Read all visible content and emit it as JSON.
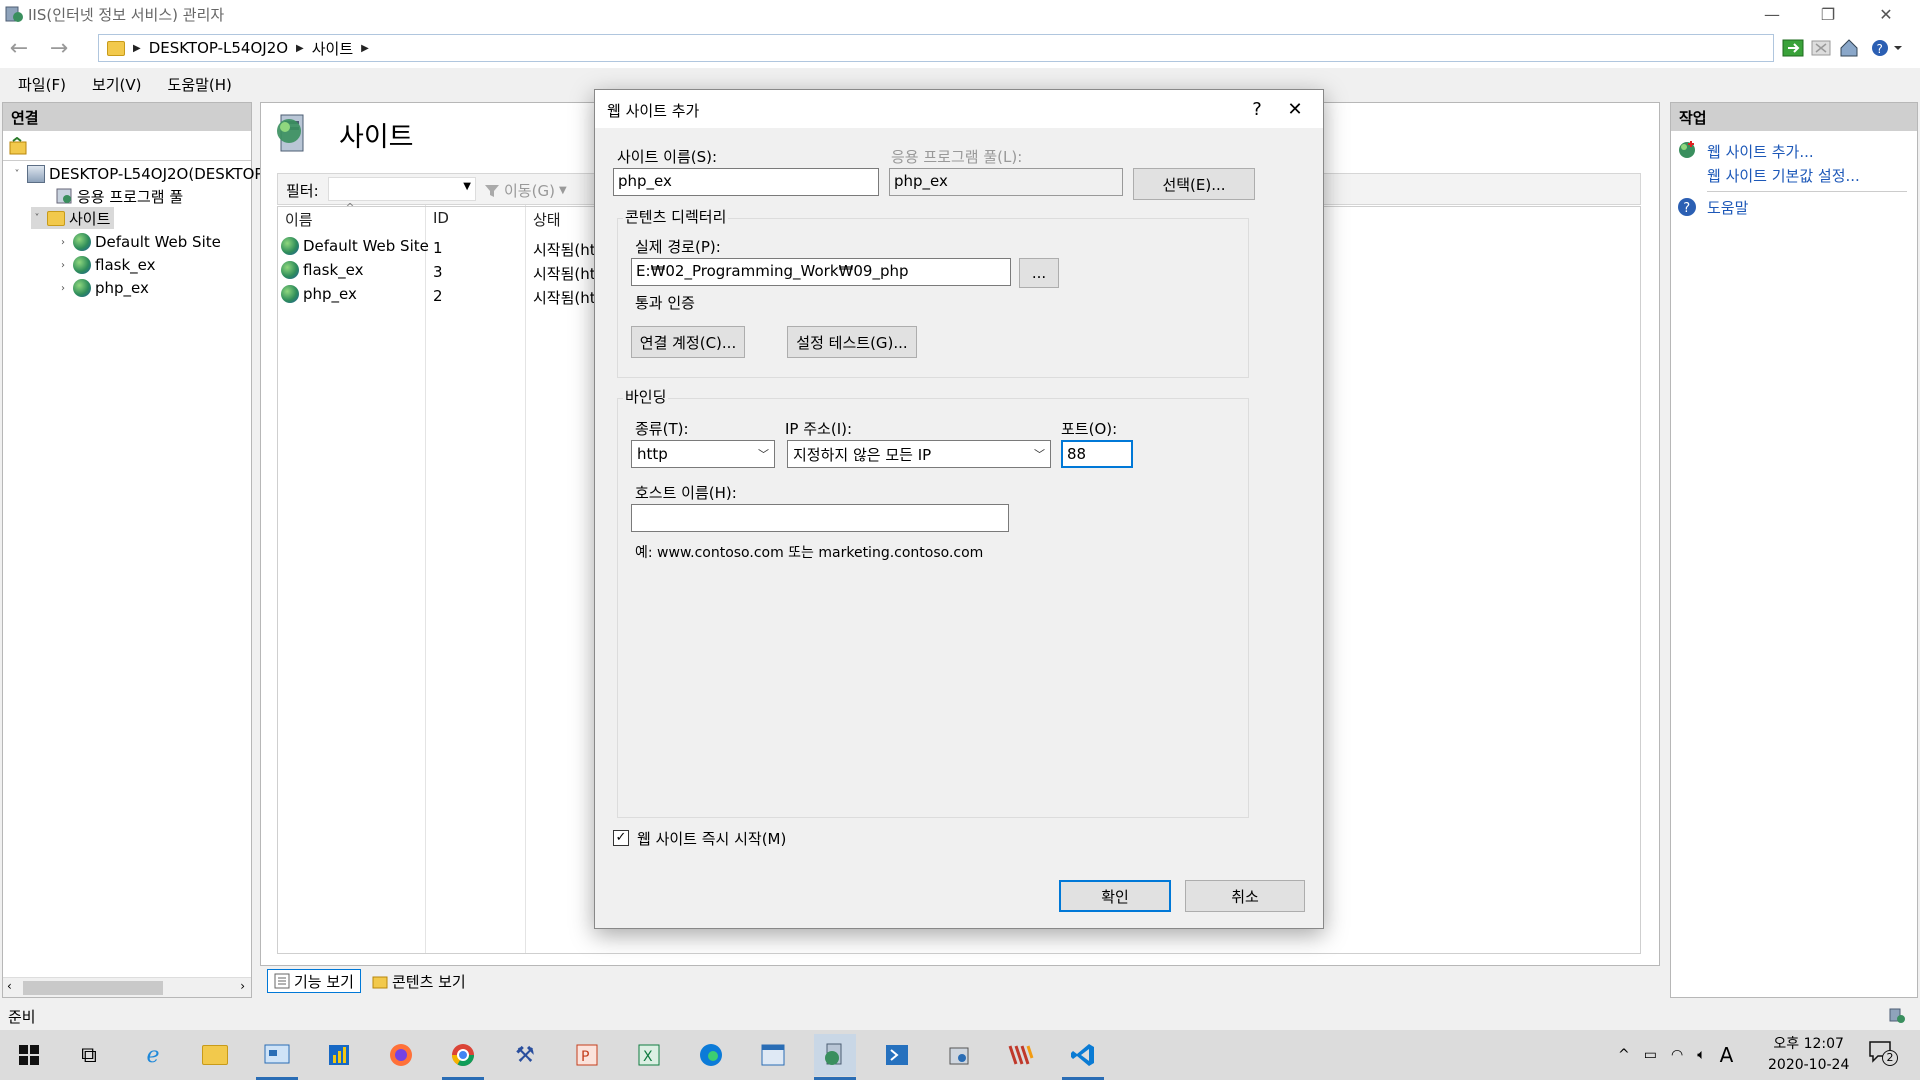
{
  "window": {
    "title": "IIS(인터넷 정보 서비스) 관리자"
  },
  "address": {
    "crumbs": [
      "DESKTOP-L54OJ2O",
      "사이트"
    ]
  },
  "menu": {
    "items": [
      "파일(F)",
      "보기(V)",
      "도움말(H)"
    ]
  },
  "connections": {
    "header": "연결",
    "tree": {
      "server": "DESKTOP-L54OJ2O(DESKTOP",
      "app_pools": "응용 프로그램 풀",
      "sites": "사이트",
      "site_items": [
        "Default Web Site",
        "flask_ex",
        "php_ex"
      ]
    }
  },
  "center": {
    "title": "사이트",
    "filter_label": "필터:",
    "go_label": "이동(G)",
    "columns": [
      "이름",
      "ID",
      "상태"
    ],
    "rows": [
      {
        "name": "Default Web Site",
        "id": "1",
        "status": "시작됨(ht"
      },
      {
        "name": "flask_ex",
        "id": "3",
        "status": "시작됨(ht"
      },
      {
        "name": "php_ex",
        "id": "2",
        "status": "시작됨(ht"
      }
    ],
    "tabs": [
      "기능 보기",
      "콘텐츠 보기"
    ]
  },
  "actions": {
    "header": "작업",
    "add_site": "웹 사이트 추가...",
    "site_defaults": "웹 사이트 기본값 설정...",
    "help": "도움말"
  },
  "status": {
    "text": "준비"
  },
  "dialog": {
    "title": "웹 사이트 추가",
    "help_glyph": "?",
    "site_name_label": "사이트 이름(S):",
    "site_name_value": "php_ex",
    "app_pool_label": "응용 프로그램 풀(L):",
    "app_pool_value": "php_ex",
    "select_button": "선택(E)...",
    "content_dir_label": "콘텐츠 디렉터리",
    "physical_path_label": "실제 경로(P):",
    "physical_path_value": "E:₩02_Programming_Work₩09_php",
    "browse_button": "...",
    "pass_auth_label": "통과 인증",
    "connect_as_button": "연결 계정(C)...",
    "test_settings_button": "설정 테스트(G)...",
    "binding_label": "바인딩",
    "type_label": "종류(T):",
    "type_value": "http",
    "ip_label": "IP 주소(I):",
    "ip_value": "지정하지 않은 모든 IP",
    "port_label": "포트(O):",
    "port_value": "88",
    "host_label": "호스트 이름(H):",
    "host_value": "",
    "example_text": "예: www.contoso.com 또는 marketing.contoso.com",
    "start_immediately_label": "웹 사이트 즉시 시작(M)",
    "start_immediately_checked": true,
    "ok_button": "확인",
    "cancel_button": "취소"
  },
  "taskbar": {
    "time": "오후 12:07",
    "date": "2020-10-24",
    "ime": "A",
    "notification_count": "2"
  }
}
